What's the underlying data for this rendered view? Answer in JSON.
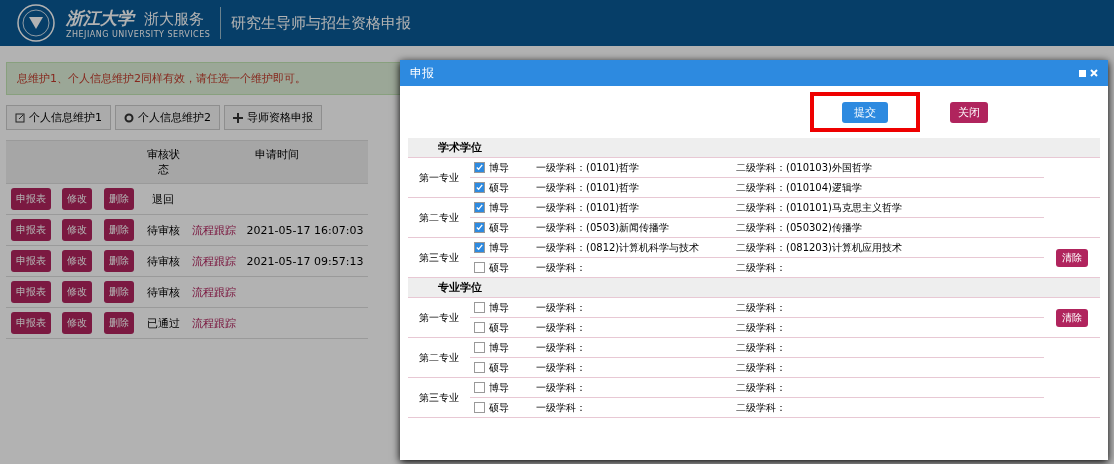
{
  "header": {
    "logo_text": "浙江大学",
    "service": "浙大服务",
    "service_en": "ZHEJIANG UNIVERSITY SERVICES",
    "title": "研究生导师与招生资格申报"
  },
  "notice": "息维护1、个人信息维护2同样有效，请任选一个维护即可。",
  "toolbar": [
    {
      "kind": "edit",
      "label": "个人信息维护1"
    },
    {
      "kind": "gear",
      "label": "个人信息维护2"
    },
    {
      "kind": "plus",
      "label": "导师资格申报"
    }
  ],
  "table": {
    "columns": [
      "审核状态",
      "申请时间"
    ],
    "rows": [
      {
        "actions": [
          "申报表",
          "修改",
          "删除"
        ],
        "status": "退回",
        "track": "",
        "time": ""
      },
      {
        "actions": [
          "申报表",
          "修改",
          "删除"
        ],
        "status": "待审核",
        "track": "流程跟踪",
        "time": "2021-05-17 16:07:03"
      },
      {
        "actions": [
          "申报表",
          "修改",
          "删除"
        ],
        "status": "待审核",
        "track": "流程跟踪",
        "time": "2021-05-17 09:57:13"
      },
      {
        "actions": [
          "申报表",
          "修改",
          "删除"
        ],
        "status": "待审核",
        "track": "流程跟踪",
        "time": ""
      },
      {
        "actions": [
          "申报表",
          "修改",
          "删除"
        ],
        "status": "已通过",
        "track": "流程跟踪",
        "time": ""
      }
    ]
  },
  "dialog": {
    "title": "申报",
    "submit": "提交",
    "close": "关闭",
    "sections": [
      {
        "title": "学术学位",
        "majors": [
          {
            "name": "第一专业",
            "rows": [
              {
                "role": "博导",
                "checked": true,
                "level1": "一级学科：(0101)哲学",
                "level2": "二级学科：(010103)外国哲学"
              },
              {
                "role": "硕导",
                "checked": true,
                "level1": "一级学科：(0101)哲学",
                "level2": "二级学科：(010104)逻辑学"
              }
            ]
          },
          {
            "name": "第二专业",
            "rows": [
              {
                "role": "博导",
                "checked": true,
                "level1": "一级学科：(0101)哲学",
                "level2": "二级学科：(010101)马克思主义哲学"
              },
              {
                "role": "硕导",
                "checked": true,
                "level1": "一级学科：(0503)新闻传播学",
                "level2": "二级学科：(050302)传播学"
              }
            ]
          },
          {
            "name": "第三专业",
            "rows": [
              {
                "role": "博导",
                "checked": true,
                "level1": "一级学科：(0812)计算机科学与技术",
                "level2": "二级学科：(081203)计算机应用技术"
              },
              {
                "role": "硕导",
                "checked": false,
                "level1": "一级学科：",
                "level2": "二级学科："
              }
            ],
            "clear": "清除"
          }
        ]
      },
      {
        "title": "专业学位",
        "majors": [
          {
            "name": "第一专业",
            "rows": [
              {
                "role": "博导",
                "checked": false,
                "level1": "一级学科：",
                "level2": "二级学科："
              },
              {
                "role": "硕导",
                "checked": false,
                "level1": "一级学科：",
                "level2": "二级学科："
              }
            ],
            "clear": "清除"
          },
          {
            "name": "第二专业",
            "rows": [
              {
                "role": "博导",
                "checked": false,
                "level1": "一级学科：",
                "level2": "二级学科："
              },
              {
                "role": "硕导",
                "checked": false,
                "level1": "一级学科：",
                "level2": "二级学科："
              }
            ]
          },
          {
            "name": "第三专业",
            "rows": [
              {
                "role": "博导",
                "checked": false,
                "level1": "一级学科：",
                "level2": "二级学科："
              },
              {
                "role": "硕导",
                "checked": false,
                "level1": "一级学科：",
                "level2": "二级学科："
              }
            ]
          }
        ]
      }
    ]
  }
}
